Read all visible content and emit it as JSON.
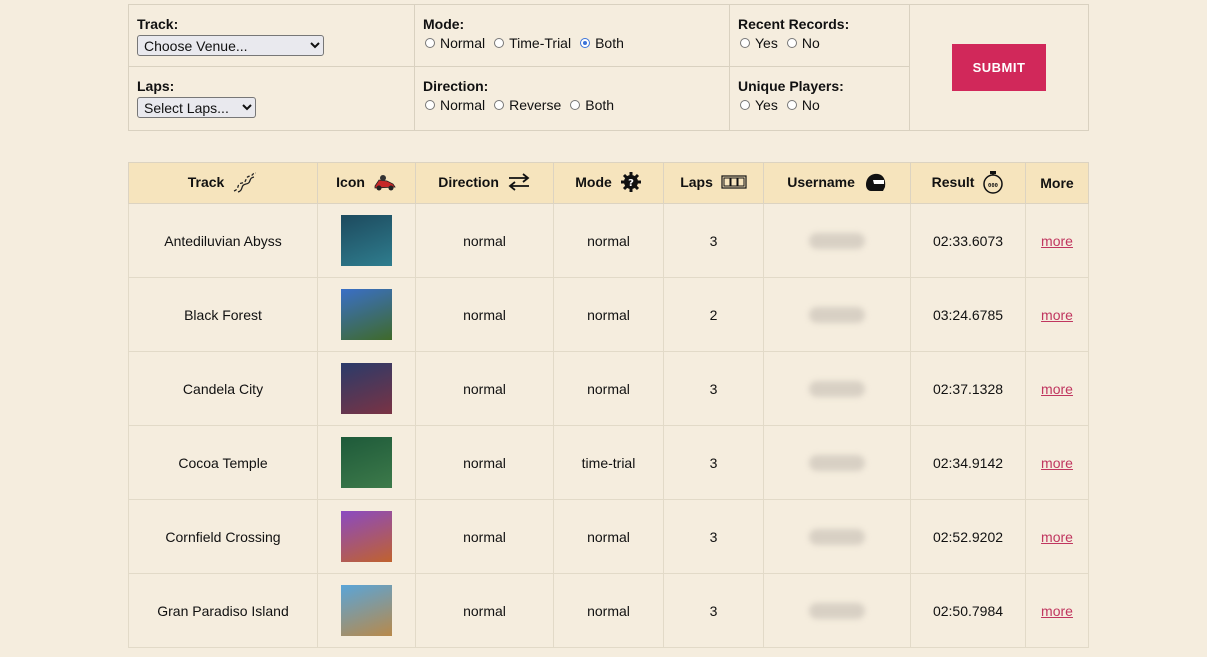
{
  "filters": {
    "track": {
      "label": "Track:",
      "selected": "Choose Venue..."
    },
    "laps": {
      "label": "Laps:",
      "selected": "Select Laps..."
    },
    "mode": {
      "label": "Mode:",
      "options": [
        "Normal",
        "Time-Trial",
        "Both"
      ],
      "checked": "Both"
    },
    "direction": {
      "label": "Direction:",
      "options": [
        "Normal",
        "Reverse",
        "Both"
      ],
      "checked": ""
    },
    "recent_records": {
      "label": "Recent Records:",
      "options": [
        "Yes",
        "No"
      ],
      "checked": ""
    },
    "unique_players": {
      "label": "Unique Players:",
      "options": [
        "Yes",
        "No"
      ],
      "checked": ""
    },
    "submit_label": "SUBMIT"
  },
  "table": {
    "headers": {
      "track": "Track",
      "icon": "Icon",
      "direction": "Direction",
      "mode": "Mode",
      "laps": "Laps",
      "username": "Username",
      "result": "Result",
      "more": "More"
    },
    "rows": [
      {
        "track": "Antediluvian Abyss",
        "direction": "normal",
        "mode": "normal",
        "laps": "3",
        "result": "02:33.6073",
        "more": "more",
        "thumb_colors": [
          "#1d4a5e",
          "#2f7d8e"
        ]
      },
      {
        "track": "Black Forest",
        "direction": "normal",
        "mode": "normal",
        "laps": "2",
        "result": "03:24.6785",
        "more": "more",
        "thumb_colors": [
          "#3a6fc7",
          "#3f6a2a"
        ]
      },
      {
        "track": "Candela City",
        "direction": "normal",
        "mode": "normal",
        "laps": "3",
        "result": "02:37.1328",
        "more": "more",
        "thumb_colors": [
          "#2a3b6a",
          "#7a3344"
        ]
      },
      {
        "track": "Cocoa Temple",
        "direction": "normal",
        "mode": "time-trial",
        "laps": "3",
        "result": "02:34.9142",
        "more": "more",
        "thumb_colors": [
          "#1e5a3a",
          "#3d7a4a"
        ]
      },
      {
        "track": "Cornfield Crossing",
        "direction": "normal",
        "mode": "normal",
        "laps": "3",
        "result": "02:52.9202",
        "more": "more",
        "thumb_colors": [
          "#8a4ac2",
          "#c0622e"
        ]
      },
      {
        "track": "Gran Paradiso Island",
        "direction": "normal",
        "mode": "normal",
        "laps": "3",
        "result": "02:50.7984",
        "more": "more",
        "thumb_colors": [
          "#5aa5d8",
          "#b8894a"
        ]
      }
    ]
  }
}
